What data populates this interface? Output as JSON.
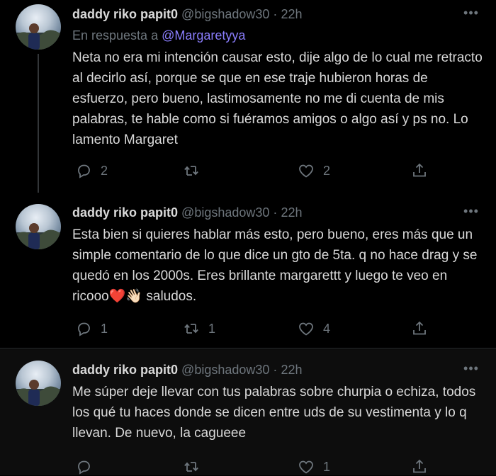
{
  "tweets": [
    {
      "name": "daddy riko papit0",
      "handle": "@bigshadow30",
      "separator": "·",
      "time": "22h",
      "reply_prefix": "En respuesta a",
      "reply_to": "@Margaretyya",
      "text": "Neta no era mi intención causar esto, dije algo de lo cual me retracto al decirlo así, porque se que en ese traje hubieron horas de esfuerzo, pero bueno, lastimosamente no me di cuenta de mis palabras, te hable como si fuéramos amigos o algo así y ps no. Lo lamento Margaret",
      "replies": "2",
      "retweets": "",
      "likes": "2"
    },
    {
      "name": "daddy riko papit0",
      "handle": "@bigshadow30",
      "separator": "·",
      "time": "22h",
      "text_before_emoji": "Esta bien si quieres hablar más esto, pero bueno, eres más que un simple comentario de lo que dice un gto de 5ta. q no hace drag y se quedó en los 2000s. Eres brillante margarettt y luego te veo en ricooo",
      "emoji_heart": "❤️",
      "emoji_wave": "👋🏻",
      "text_after_emoji": " saludos.",
      "replies": "1",
      "retweets": "1",
      "likes": "4"
    },
    {
      "name": "daddy riko papit0",
      "handle": "@bigshadow30",
      "separator": "·",
      "time": "22h",
      "text": "Me súper deje llevar con tus palabras sobre churpia o echiza, todos los qué tu haces donde se dicen entre uds de su vestimenta y lo q llevan. De nuevo, la cagueee",
      "replies": "",
      "retweets": "",
      "likes": "1"
    }
  ],
  "more_glyph": "•••",
  "colors": {
    "background": "#000000",
    "text": "#d9d9d9",
    "secondary": "#6e767d",
    "mention": "#8a7dfc",
    "thread_line": "#333639"
  },
  "icons": [
    "reply-icon",
    "retweet-icon",
    "like-icon",
    "share-icon",
    "more-icon"
  ]
}
